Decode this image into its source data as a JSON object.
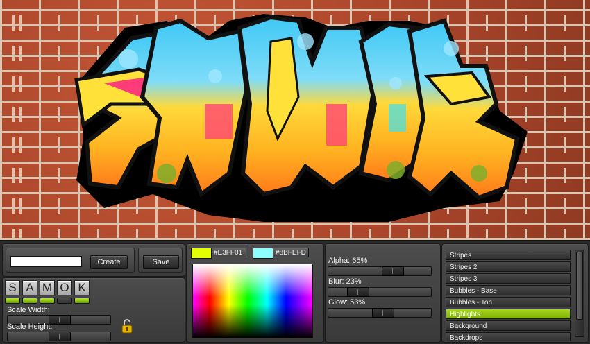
{
  "toolbar": {
    "name_value": "",
    "create_label": "Create",
    "save_label": "Save"
  },
  "letters": [
    "S",
    "A",
    "M",
    "O",
    "K"
  ],
  "leds": [
    true,
    true,
    true,
    false,
    true
  ],
  "scale": {
    "width_label": "Scale Width:",
    "height_label": "Scale Height:",
    "width_value": 0.5,
    "height_value": 0.5
  },
  "colors": {
    "color1_hex": "#E3FF01",
    "color2_hex": "#8BFEFD",
    "color1": "#E3FF01",
    "color2": "#8BFEFD"
  },
  "effects": {
    "alpha_label": "Alpha: 65%",
    "blur_label": "Blur: 23%",
    "glow_label": "Glow: 53%",
    "alpha": 65,
    "blur": 23,
    "glow": 53
  },
  "layers": [
    {
      "label": "Stripes",
      "selected": false
    },
    {
      "label": "Stripes 2",
      "selected": false
    },
    {
      "label": "Stripes 3",
      "selected": false
    },
    {
      "label": "Bubbles - Base",
      "selected": false
    },
    {
      "label": "Bubbles - Top",
      "selected": false
    },
    {
      "label": "Highlights",
      "selected": true
    },
    {
      "label": "Background",
      "selected": false
    },
    {
      "label": "Backdrops",
      "selected": false
    }
  ]
}
